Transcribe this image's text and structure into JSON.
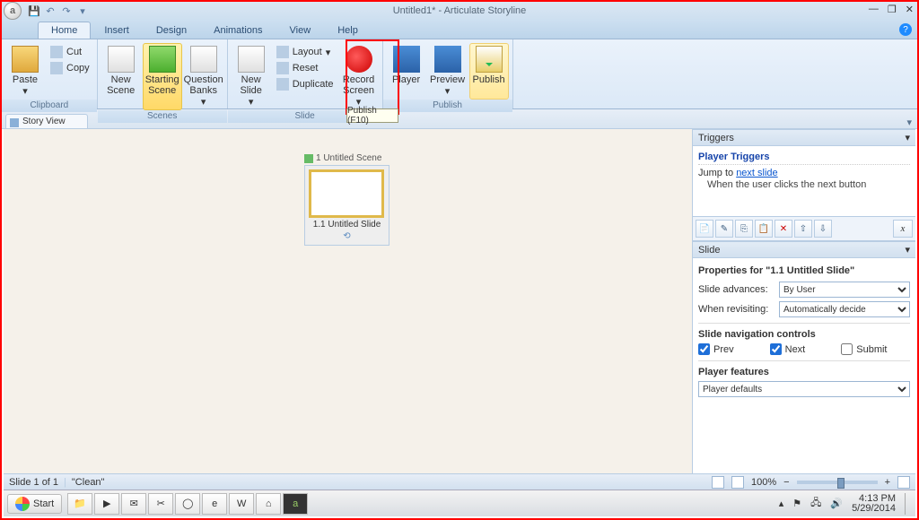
{
  "title": "Untitled1* -  Articulate Storyline",
  "tabs": [
    "Home",
    "Insert",
    "Design",
    "Animations",
    "View",
    "Help"
  ],
  "activeTab": "Home",
  "groups": {
    "clipboard": {
      "label": "Clipboard",
      "paste": "Paste",
      "cut": "Cut",
      "copy": "Copy"
    },
    "scenes": {
      "label": "Scenes",
      "newScene": "New Scene",
      "starting": "Starting Scene",
      "question": "Question Banks"
    },
    "slide": {
      "label": "Slide",
      "newSlide": "New Slide",
      "layout": "Layout",
      "reset": "Reset",
      "duplicate": "Duplicate",
      "record": "Record Screen"
    },
    "publish": {
      "label": "Publish",
      "player": "Player",
      "preview": "Preview",
      "publish": "Publish"
    }
  },
  "tooltip": "Publish (F10)",
  "docTab": "Story View",
  "scene": {
    "title": "1 Untitled Scene",
    "slide": "1.1 Untitled Slide"
  },
  "triggers": {
    "panel": "Triggers",
    "sub": "Player Triggers",
    "action": "Jump to ",
    "link": "next slide",
    "when": "When the user clicks the next button"
  },
  "slidePanel": {
    "panel": "Slide",
    "props": "Properties for \"1.1 Untitled Slide\"",
    "advances": {
      "label": "Slide advances:",
      "value": "By User"
    },
    "revisit": {
      "label": "When revisiting:",
      "value": "Automatically decide"
    },
    "navhd": "Slide navigation controls",
    "prev": "Prev",
    "next": "Next",
    "submit": "Submit",
    "feathd": "Player features",
    "feat": "Player defaults"
  },
  "status": {
    "left": "Slide 1 of 1",
    "theme": "\"Clean\"",
    "zoom": "100%"
  },
  "start": "Start",
  "clock": {
    "time": "4:13 PM",
    "date": "5/29/2014"
  }
}
